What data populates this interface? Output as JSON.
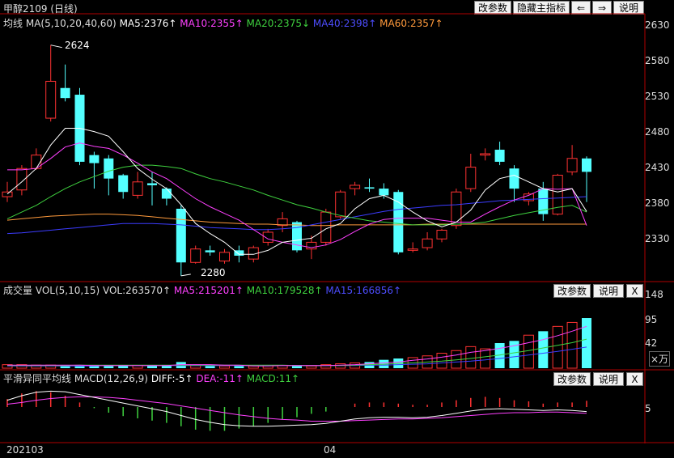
{
  "title": {
    "name": "甲醇2109",
    "period": "(日线)"
  },
  "toolbar": {
    "change_params": "改参数",
    "hide_indicator": "隐藏主指标",
    "left_arrow": "⇐",
    "right_arrow": "⇒",
    "help": "说明"
  },
  "main_legend": {
    "label": "均线",
    "params": "MA(5,10,20,40,60)",
    "ma5": "MA5:2376↑",
    "ma10": "MA10:2355↑",
    "ma20": "MA20:2375↓",
    "ma40": "MA40:2398↑",
    "ma60": "MA60:2357↑"
  },
  "price_axis": [
    "2630",
    "2580",
    "2530",
    "2480",
    "2430",
    "2380",
    "2330"
  ],
  "annotations": {
    "high": "2624",
    "low": "2280"
  },
  "vol_panel": {
    "title": "成交量",
    "params": "VOL(5,10,15)",
    "vol": "VOL:263570↑",
    "ma5": "MA5:215201↑",
    "ma10": "MA10:179528↑",
    "ma15": "MA15:166856↑",
    "change_params": "改参数",
    "help": "说明",
    "close": "X",
    "axis": [
      "148",
      "95",
      "42"
    ],
    "unit": "×万"
  },
  "macd_panel": {
    "title": "平滑异同平均线",
    "params": "MACD(12,26,9)",
    "diff": "DIFF:-5↑",
    "dea": "DEA:-11↑",
    "macd": "MACD:11↑",
    "change_params": "改参数",
    "help": "说明",
    "close": "X",
    "axis": [
      "5"
    ]
  },
  "date_axis": {
    "start": "202103",
    "mid": "04"
  },
  "colors": {
    "up": "#ff3232",
    "down": "#54ffff",
    "ma5": "#ffffff",
    "ma10": "#ff40ff",
    "ma20": "#3fd23f",
    "ma40": "#3c3cff",
    "ma60": "#ff9a3c",
    "axis": "#b00000"
  },
  "chart_data": {
    "type": "candlestick",
    "price_range": [
      2275,
      2655
    ],
    "candles": [
      {
        "o": 2398,
        "c": 2405,
        "h": 2420,
        "l": 2390
      },
      {
        "o": 2408,
        "c": 2440,
        "h": 2445,
        "l": 2400
      },
      {
        "o": 2440,
        "c": 2460,
        "h": 2470,
        "l": 2438
      },
      {
        "o": 2515,
        "c": 2570,
        "h": 2624,
        "l": 2510
      },
      {
        "o": 2560,
        "c": 2545,
        "h": 2595,
        "l": 2540
      },
      {
        "o": 2550,
        "c": 2450,
        "h": 2560,
        "l": 2445
      },
      {
        "o": 2460,
        "c": 2448,
        "h": 2465,
        "l": 2410
      },
      {
        "o": 2455,
        "c": 2425,
        "h": 2460,
        "l": 2400
      },
      {
        "o": 2430,
        "c": 2405,
        "h": 2432,
        "l": 2395
      },
      {
        "o": 2400,
        "c": 2420,
        "h": 2435,
        "l": 2395
      },
      {
        "o": 2418,
        "c": 2415,
        "h": 2435,
        "l": 2385
      },
      {
        "o": 2410,
        "c": 2395,
        "h": 2412,
        "l": 2385
      },
      {
        "o": 2380,
        "c": 2300,
        "h": 2385,
        "l": 2280
      },
      {
        "o": 2300,
        "c": 2320,
        "h": 2325,
        "l": 2298
      },
      {
        "o": 2318,
        "c": 2315,
        "h": 2325,
        "l": 2310
      },
      {
        "o": 2302,
        "c": 2315,
        "h": 2320,
        "l": 2298
      },
      {
        "o": 2318,
        "c": 2310,
        "h": 2325,
        "l": 2300
      },
      {
        "o": 2305,
        "c": 2322,
        "h": 2325,
        "l": 2300
      },
      {
        "o": 2330,
        "c": 2345,
        "h": 2350,
        "l": 2325
      },
      {
        "o": 2355,
        "c": 2365,
        "h": 2375,
        "l": 2345
      },
      {
        "o": 2360,
        "c": 2318,
        "h": 2362,
        "l": 2315
      },
      {
        "o": 2320,
        "c": 2330,
        "h": 2340,
        "l": 2305
      },
      {
        "o": 2330,
        "c": 2375,
        "h": 2380,
        "l": 2325
      },
      {
        "o": 2368,
        "c": 2405,
        "h": 2408,
        "l": 2365
      },
      {
        "o": 2410,
        "c": 2415,
        "h": 2420,
        "l": 2400
      },
      {
        "o": 2412,
        "c": 2410,
        "h": 2425,
        "l": 2405
      },
      {
        "o": 2410,
        "c": 2400,
        "h": 2418,
        "l": 2395
      },
      {
        "o": 2405,
        "c": 2315,
        "h": 2408,
        "l": 2312
      },
      {
        "o": 2318,
        "c": 2320,
        "h": 2330,
        "l": 2315
      },
      {
        "o": 2322,
        "c": 2335,
        "h": 2345,
        "l": 2318
      },
      {
        "o": 2335,
        "c": 2348,
        "h": 2350,
        "l": 2330
      },
      {
        "o": 2355,
        "c": 2405,
        "h": 2410,
        "l": 2350
      },
      {
        "o": 2410,
        "c": 2442,
        "h": 2462,
        "l": 2405
      },
      {
        "o": 2460,
        "c": 2462,
        "h": 2470,
        "l": 2452
      },
      {
        "o": 2468,
        "c": 2450,
        "h": 2480,
        "l": 2445
      },
      {
        "o": 2440,
        "c": 2410,
        "h": 2445,
        "l": 2390
      },
      {
        "o": 2392,
        "c": 2402,
        "h": 2405,
        "l": 2385
      },
      {
        "o": 2410,
        "c": 2372,
        "h": 2420,
        "l": 2362
      },
      {
        "o": 2372,
        "c": 2430,
        "h": 2432,
        "l": 2370
      },
      {
        "o": 2435,
        "c": 2455,
        "h": 2475,
        "l": 2430
      },
      {
        "o": 2455,
        "c": 2435,
        "h": 2458,
        "l": 2390
      }
    ],
    "ma5": [
      2402,
      2420,
      2440,
      2475,
      2500,
      2500,
      2495,
      2488,
      2465,
      2440,
      2424,
      2410,
      2386,
      2358,
      2343,
      2330,
      2312,
      2312,
      2318,
      2330,
      2333,
      2336,
      2350,
      2358,
      2380,
      2395,
      2400,
      2390,
      2375,
      2362,
      2353,
      2360,
      2378,
      2408,
      2425,
      2430,
      2420,
      2410,
      2405,
      2410,
      2376
    ],
    "ma10": [
      2438,
      2438,
      2440,
      2455,
      2472,
      2478,
      2473,
      2470,
      2460,
      2448,
      2435,
      2425,
      2410,
      2395,
      2383,
      2373,
      2363,
      2349,
      2335,
      2330,
      2326,
      2322,
      2326,
      2334,
      2346,
      2357,
      2364,
      2366,
      2366,
      2366,
      2363,
      2360,
      2360,
      2372,
      2383,
      2393,
      2400,
      2410,
      2409,
      2410,
      2355
    ],
    "ma20": [
      2365,
      2375,
      2385,
      2398,
      2410,
      2420,
      2428,
      2436,
      2442,
      2445,
      2445,
      2443,
      2440,
      2432,
      2425,
      2420,
      2414,
      2408,
      2400,
      2393,
      2386,
      2381,
      2375,
      2370,
      2366,
      2362,
      2360,
      2358,
      2356,
      2356,
      2356,
      2357,
      2358,
      2360,
      2365,
      2370,
      2374,
      2378,
      2382,
      2385,
      2375
    ],
    "ma40": [
      2343,
      2344,
      2346,
      2348,
      2350,
      2352,
      2354,
      2356,
      2358,
      2358,
      2358,
      2357,
      2356,
      2354,
      2352,
      2351,
      2350,
      2349,
      2349,
      2350,
      2352,
      2356,
      2360,
      2364,
      2368,
      2372,
      2376,
      2379,
      2381,
      2383,
      2385,
      2386,
      2388,
      2390,
      2392,
      2393,
      2394,
      2395,
      2396,
      2397,
      2398
    ],
    "ma60": [
      2363,
      2365,
      2367,
      2369,
      2370,
      2371,
      2372,
      2372,
      2371,
      2370,
      2368,
      2366,
      2364,
      2362,
      2360,
      2359,
      2358,
      2357,
      2357,
      2356,
      2356,
      2355,
      2355,
      2356,
      2356,
      2356,
      2356,
      2356,
      2356,
      2357,
      2357,
      2357,
      2357,
      2357,
      2357,
      2357,
      2357,
      2357,
      2357,
      2357,
      2357
    ],
    "volume_range": [
      0,
      160
    ],
    "volume": [
      8,
      8,
      7,
      7,
      7,
      6,
      5,
      5,
      6,
      6,
      6,
      7,
      14,
      6,
      5,
      5,
      5,
      5,
      6,
      6,
      5,
      5,
      8,
      10,
      12,
      14,
      19,
      22,
      24,
      28,
      34,
      40,
      49,
      44,
      57,
      62,
      75,
      84,
      95,
      104,
      114
    ],
    "vol_ma5": [
      7,
      7,
      7,
      7,
      7,
      7,
      6,
      6,
      6,
      6,
      6,
      6,
      8,
      8,
      8,
      7,
      7,
      5,
      5,
      6,
      6,
      6,
      6,
      7,
      8,
      10,
      12,
      14,
      18,
      21,
      25,
      30,
      36,
      40,
      45,
      51,
      58,
      65,
      74,
      84,
      95
    ],
    "vol_ma10": [
      6,
      6,
      6,
      6,
      6,
      7,
      7,
      7,
      7,
      7,
      7,
      7,
      7,
      7,
      7,
      7,
      7,
      7,
      7,
      7,
      6,
      6,
      6,
      6,
      7,
      8,
      9,
      11,
      12,
      14,
      16,
      19,
      22,
      26,
      30,
      35,
      40,
      46,
      52,
      58,
      66
    ],
    "vol_ma15": [
      5,
      5,
      5,
      5,
      5,
      5,
      5,
      6,
      6,
      6,
      6,
      6,
      6,
      6,
      6,
      6,
      6,
      6,
      6,
      6,
      6,
      6,
      6,
      6,
      6,
      7,
      7,
      8,
      9,
      10,
      12,
      14,
      16,
      19,
      22,
      26,
      30,
      34,
      38,
      43,
      48
    ],
    "macd_range": [
      -60,
      40
    ],
    "diff": [
      12,
      20,
      26,
      28,
      27,
      22,
      17,
      12,
      7,
      2,
      -3,
      -8,
      -15,
      -22,
      -27,
      -31,
      -33,
      -34,
      -34,
      -33,
      -32,
      -31,
      -29,
      -25,
      -21,
      -19,
      -18,
      -18,
      -19,
      -18,
      -15,
      -11,
      -7,
      -4,
      -3,
      -4,
      -5,
      -6,
      -5,
      -6,
      -8
    ],
    "dea": [
      5,
      8,
      12,
      15,
      17,
      18,
      18,
      17,
      15,
      12,
      9,
      6,
      2,
      -2,
      -6,
      -10,
      -14,
      -17,
      -20,
      -22,
      -23,
      -25,
      -25,
      -25,
      -24,
      -23,
      -22,
      -21,
      -21,
      -20,
      -19,
      -17,
      -15,
      -13,
      -11,
      -10,
      -10,
      -9,
      -9,
      -10,
      -11
    ],
    "macd": [
      14,
      24,
      28,
      26,
      20,
      8,
      -2,
      -10,
      -16,
      -20,
      -24,
      -28,
      -34,
      -40,
      -42,
      -42,
      -38,
      -34,
      -28,
      -22,
      -18,
      -12,
      -8,
      0,
      6,
      8,
      8,
      6,
      4,
      4,
      8,
      12,
      16,
      18,
      16,
      12,
      10,
      6,
      8,
      8,
      11
    ]
  }
}
